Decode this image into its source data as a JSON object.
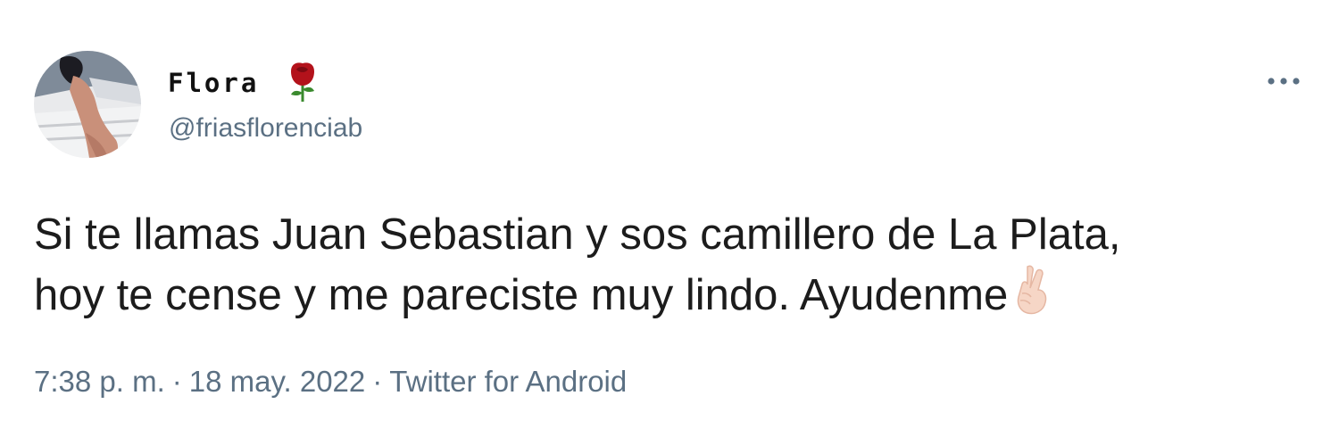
{
  "author": {
    "display_name": "Flora",
    "handle": "@friasflorenciab",
    "name_emoji": "rose-icon"
  },
  "tweet": {
    "text_line1": "Si te llamas Juan Sebastian y sos camillero de La Plata,",
    "text_line2": "hoy te cense y me pareciste muy lindo. Ayudenme",
    "trailing_emoji": "crossed-fingers-icon"
  },
  "meta": {
    "time": "7:38 p. m.",
    "separator": "·",
    "date": "18 may. 2022",
    "source": "Twitter for Android"
  },
  "menu": {
    "icon": "more-options-icon"
  },
  "colors": {
    "text": "#1c1c1c",
    "secondary": "#5b7083",
    "rose": "#b3121b"
  }
}
